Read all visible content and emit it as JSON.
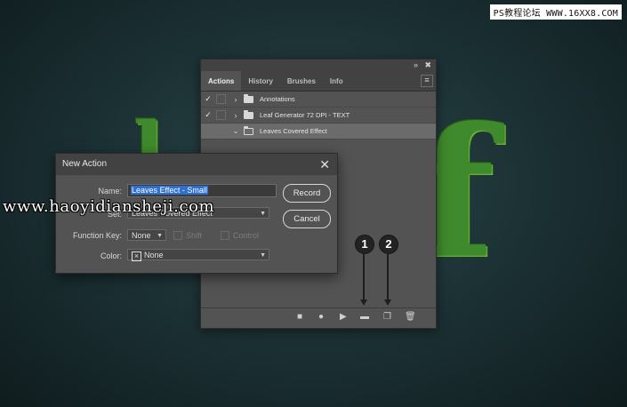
{
  "watermark_top": "PS教程论坛 WWW.16XX8.COM",
  "watermark_band": "www.haoyidiansheji.com",
  "background_letters": {
    "left": "l",
    "right": "f"
  },
  "actions_panel": {
    "tabs": [
      {
        "label": "Actions",
        "active": true
      },
      {
        "label": "History",
        "active": false
      },
      {
        "label": "Brushes",
        "active": false
      },
      {
        "label": "Info",
        "active": false
      }
    ],
    "rows": [
      {
        "label": "Annotations",
        "checked": true,
        "expanded": false,
        "selected": false
      },
      {
        "label": "Leaf Generator 72 DPI - TEXT",
        "checked": true,
        "expanded": false,
        "selected": false
      },
      {
        "label": "Leaves Covered Effect",
        "checked": false,
        "expanded": true,
        "selected": true
      }
    ],
    "bottom_icons": [
      "stop-icon",
      "record-icon",
      "play-icon",
      "new-set-icon",
      "new-action-icon",
      "trash-icon"
    ]
  },
  "markers": [
    "1",
    "2"
  ],
  "dialog": {
    "title": "New Action",
    "name_label": "Name:",
    "name_value": "Leaves Effect - Small",
    "set_label": "Set:",
    "set_value": "Leaves Covered Effect",
    "function_key_label": "Function Key:",
    "function_key_value": "None",
    "shift_label": "Shift",
    "control_label": "Control",
    "color_label": "Color:",
    "color_value": "None",
    "record_label": "Record",
    "cancel_label": "Cancel"
  },
  "colors": {
    "selection": "#2f6fd0",
    "panel": "#535353",
    "leaf": "#3f8a2c"
  }
}
